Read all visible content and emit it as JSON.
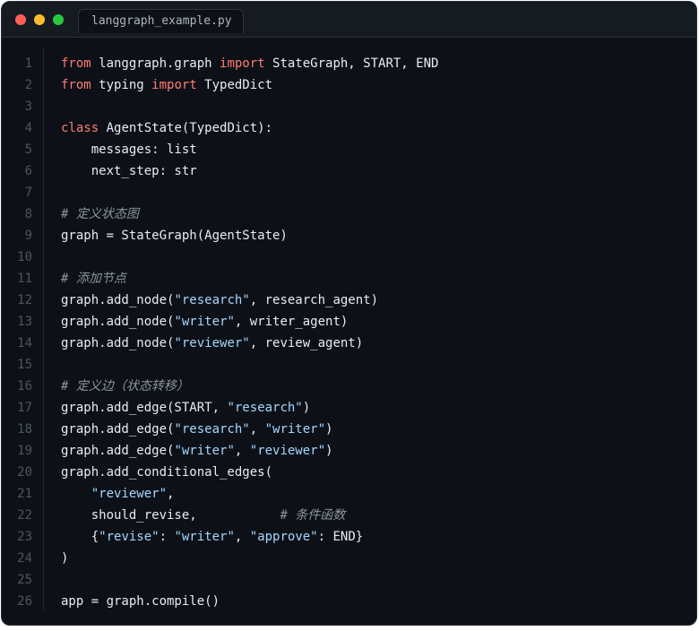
{
  "window": {
    "tab_title": "langgraph_example.py"
  },
  "code_lines": [
    {
      "n": "1",
      "tokens": [
        [
          "kw",
          "from"
        ],
        [
          "pl",
          " langgraph.graph "
        ],
        [
          "kw",
          "import"
        ],
        [
          "pl",
          " StateGraph, START, END"
        ]
      ]
    },
    {
      "n": "2",
      "tokens": [
        [
          "kw",
          "from"
        ],
        [
          "pl",
          " typing "
        ],
        [
          "kw",
          "import"
        ],
        [
          "pl",
          " TypedDict"
        ]
      ]
    },
    {
      "n": "3",
      "tokens": []
    },
    {
      "n": "4",
      "tokens": [
        [
          "kw",
          "class"
        ],
        [
          "pl",
          " AgentState(TypedDict):"
        ]
      ]
    },
    {
      "n": "5",
      "tokens": [
        [
          "pl",
          "    messages: list"
        ]
      ]
    },
    {
      "n": "6",
      "tokens": [
        [
          "pl",
          "    next_step: str"
        ]
      ]
    },
    {
      "n": "7",
      "tokens": []
    },
    {
      "n": "8",
      "tokens": [
        [
          "cmt",
          "# 定义状态图"
        ]
      ]
    },
    {
      "n": "9",
      "tokens": [
        [
          "pl",
          "graph = StateGraph(AgentState)"
        ]
      ]
    },
    {
      "n": "10",
      "tokens": []
    },
    {
      "n": "11",
      "tokens": [
        [
          "cmt",
          "# 添加节点"
        ]
      ]
    },
    {
      "n": "12",
      "tokens": [
        [
          "pl",
          "graph.add_node("
        ],
        [
          "str",
          "\"research\""
        ],
        [
          "pl",
          ", research_agent)"
        ]
      ]
    },
    {
      "n": "13",
      "tokens": [
        [
          "pl",
          "graph.add_node("
        ],
        [
          "str",
          "\"writer\""
        ],
        [
          "pl",
          ", writer_agent)"
        ]
      ]
    },
    {
      "n": "14",
      "tokens": [
        [
          "pl",
          "graph.add_node("
        ],
        [
          "str",
          "\"reviewer\""
        ],
        [
          "pl",
          ", review_agent)"
        ]
      ]
    },
    {
      "n": "15",
      "tokens": []
    },
    {
      "n": "16",
      "tokens": [
        [
          "cmt",
          "# 定义边（状态转移）"
        ]
      ]
    },
    {
      "n": "17",
      "tokens": [
        [
          "pl",
          "graph.add_edge(START, "
        ],
        [
          "str",
          "\"research\""
        ],
        [
          "pl",
          ")"
        ]
      ]
    },
    {
      "n": "18",
      "tokens": [
        [
          "pl",
          "graph.add_edge("
        ],
        [
          "str",
          "\"research\""
        ],
        [
          "pl",
          ", "
        ],
        [
          "str",
          "\"writer\""
        ],
        [
          "pl",
          ")"
        ]
      ]
    },
    {
      "n": "19",
      "tokens": [
        [
          "pl",
          "graph.add_edge("
        ],
        [
          "str",
          "\"writer\""
        ],
        [
          "pl",
          ", "
        ],
        [
          "str",
          "\"reviewer\""
        ],
        [
          "pl",
          ")"
        ]
      ]
    },
    {
      "n": "20",
      "tokens": [
        [
          "pl",
          "graph.add_conditional_edges("
        ]
      ]
    },
    {
      "n": "21",
      "tokens": [
        [
          "pl",
          "    "
        ],
        [
          "str",
          "\"reviewer\""
        ],
        [
          "pl",
          ","
        ]
      ]
    },
    {
      "n": "22",
      "tokens": [
        [
          "pl",
          "    should_revise,           "
        ],
        [
          "cmt",
          "# 条件函数"
        ]
      ]
    },
    {
      "n": "23",
      "tokens": [
        [
          "pl",
          "    {"
        ],
        [
          "str",
          "\"revise\""
        ],
        [
          "pl",
          ": "
        ],
        [
          "str",
          "\"writer\""
        ],
        [
          "pl",
          ", "
        ],
        [
          "str",
          "\"approve\""
        ],
        [
          "pl",
          ": END}"
        ]
      ]
    },
    {
      "n": "24",
      "tokens": [
        [
          "pl",
          ")"
        ]
      ]
    },
    {
      "n": "25",
      "tokens": []
    },
    {
      "n": "26",
      "tokens": [
        [
          "pl",
          "app = graph.compile()"
        ]
      ]
    }
  ]
}
